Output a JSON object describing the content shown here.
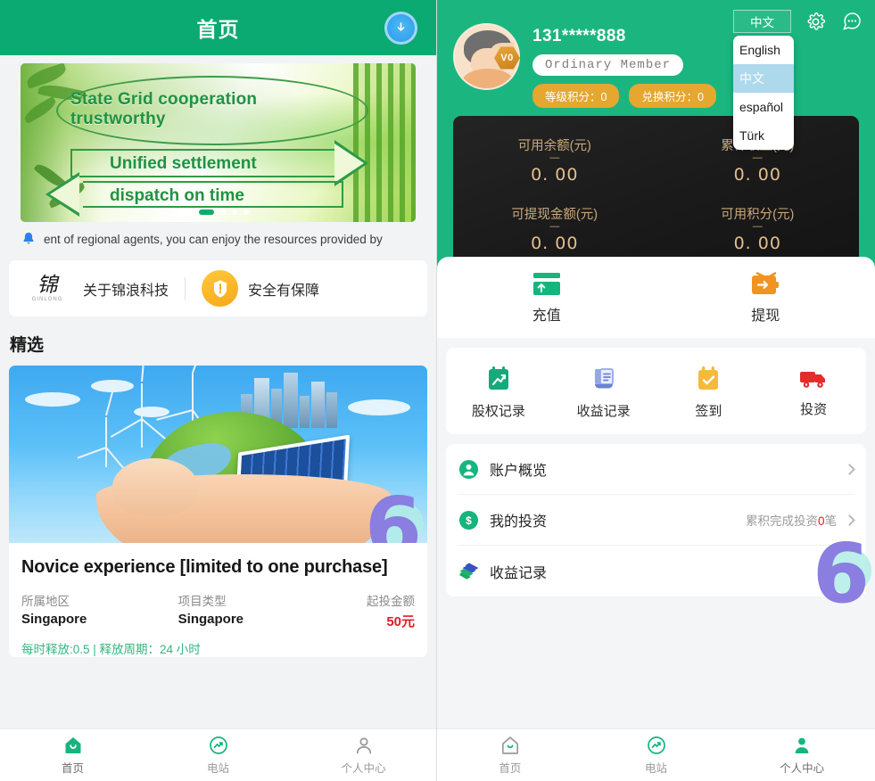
{
  "left": {
    "header": {
      "title": "首页",
      "download_icon": "download-circle-icon"
    },
    "banner": {
      "line1": "State Grid cooperation",
      "line2": "trustworthy",
      "line3": "Unified settlement",
      "line4": "dispatch on time",
      "dots_total": 5,
      "dots_active_index": 1
    },
    "notice": {
      "icon": "bell-icon",
      "text": "ent of regional agents, you can enjoy the resources provided by"
    },
    "info_card": {
      "items": [
        {
          "logo_mark": "锦",
          "logo_sub": "GINLONG",
          "label": "关于锦浪科技",
          "icon": "ginlong-logo-icon"
        },
        {
          "label": "安全有保障",
          "icon": "shield-check-icon"
        }
      ]
    },
    "section_title": "精选",
    "product": {
      "title": "Novice experience [limited to one purchase]",
      "meta": [
        {
          "key": "所属地区",
          "value": "Singapore"
        },
        {
          "key": "项目类型",
          "value": "Singapore"
        },
        {
          "key": "起投金额",
          "value": "50元"
        }
      ],
      "release": "每时释放:0.5 | 释放周期：24 小时"
    },
    "tabbar": [
      {
        "label": "首页",
        "icon": "home-icon",
        "active": true
      },
      {
        "label": "电站",
        "icon": "station-chart-icon",
        "active": false
      },
      {
        "label": "个人中心",
        "icon": "user-icon",
        "active": false
      }
    ]
  },
  "right": {
    "header": {
      "lang_selected": "中文",
      "gear_icon": "gear-icon",
      "chat_icon": "chat-dots-icon",
      "lang_options": [
        {
          "label": "English",
          "selected": false
        },
        {
          "label": "中文",
          "selected": true
        },
        {
          "label": "español",
          "selected": false
        },
        {
          "label": "Türk",
          "selected": false
        }
      ]
    },
    "user": {
      "phone": "131*****888",
      "member_level": "Ordinary Member",
      "badge": "V0",
      "points": [
        {
          "label": "等级积分：0"
        },
        {
          "label": "兑换积分：0"
        }
      ]
    },
    "balance": [
      {
        "key": "可用余额(元)",
        "value": "0. 00"
      },
      {
        "key": "累计收益(元)",
        "value": "0. 00"
      },
      {
        "key": "可提现金额(元)",
        "value": "0. 00"
      },
      {
        "key": "可用积分(元)",
        "value": "0. 00"
      }
    ],
    "actions": [
      {
        "label": "充值",
        "icon": "recharge-card-icon"
      },
      {
        "label": "提现",
        "icon": "withdraw-wallet-icon"
      }
    ],
    "quick": [
      {
        "label": "股权记录",
        "icon": "equity-record-icon"
      },
      {
        "label": "收益记录",
        "icon": "income-record-icon"
      },
      {
        "label": "签到",
        "icon": "check-in-calendar-icon"
      },
      {
        "label": "投资",
        "icon": "invest-truck-icon"
      }
    ],
    "menu": [
      {
        "label": "账户概览",
        "icon": "account-overview-icon",
        "sub": ""
      },
      {
        "label": "我的投资",
        "icon": "my-investment-icon",
        "sub_prefix": "累积完成投资",
        "sub_count": "0",
        "sub_suffix": "笔"
      },
      {
        "label": "收益记录",
        "icon": "income-list-icon",
        "sub": ""
      }
    ],
    "tabbar": [
      {
        "label": "首页",
        "icon": "home-icon",
        "active": false
      },
      {
        "label": "电站",
        "icon": "station-chart-icon",
        "active": false
      },
      {
        "label": "个人中心",
        "icon": "user-icon",
        "active": true
      }
    ]
  },
  "watermark": {
    "glyph": "6"
  },
  "colors": {
    "brand_green": "#0aaa72",
    "right_green": "#1bb680",
    "accent_gold": "#e5a72f",
    "danger_red": "#e01b24",
    "balance_text": "#e2bf8e"
  }
}
